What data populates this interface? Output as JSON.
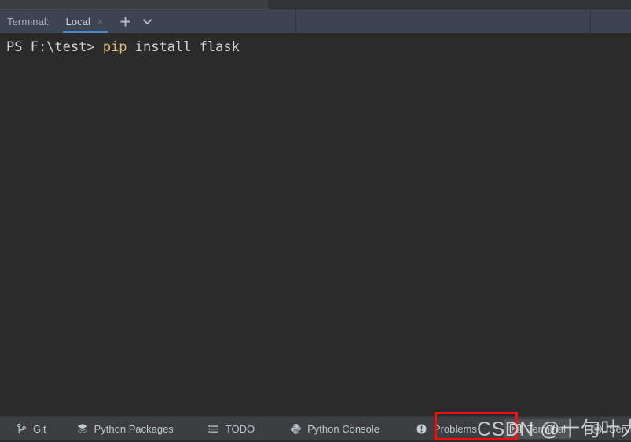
{
  "window": {
    "background_color": "#2b2b2b",
    "toolbar_color": "#3c4452",
    "statusbar_color": "#3c3f41"
  },
  "toolbar": {
    "label": "Terminal:",
    "tab": {
      "name": "Local",
      "close_glyph": "×",
      "active_underline_color": "#4a88c7"
    },
    "add_tab_glyph": "+",
    "dropdown_glyph": "⌄",
    "add_tab_name": "add-terminal-tab",
    "dropdown_name": "terminal-tab-list"
  },
  "terminal": {
    "prompt": "PS F:\\test> ",
    "command": "pip",
    "arguments": " install flask",
    "full_line": "PS F:\\test> pip install flask",
    "command_color": "#e5c07b",
    "text_color": "#d4d4d4"
  },
  "status_bar": {
    "items": [
      {
        "label": "Git",
        "icon": "git-branch-icon",
        "selected": false
      },
      {
        "label": "Python Packages",
        "icon": "layers-icon",
        "selected": false
      },
      {
        "label": "TODO",
        "icon": "list-icon",
        "selected": false
      },
      {
        "label": "Python Console",
        "icon": "python-icon",
        "selected": false
      },
      {
        "label": "Problems",
        "icon": "warning-circle-icon",
        "selected": false
      },
      {
        "label": "Terminal",
        "icon": "console-prompt-icon",
        "selected": true
      },
      {
        "label": "Services",
        "icon": "services-icon",
        "selected": false
      }
    ]
  },
  "annotation": {
    "target": "Terminal",
    "color": "#ff0a0a"
  },
  "watermark": {
    "text": "CSDN @十旬叶大叔"
  }
}
